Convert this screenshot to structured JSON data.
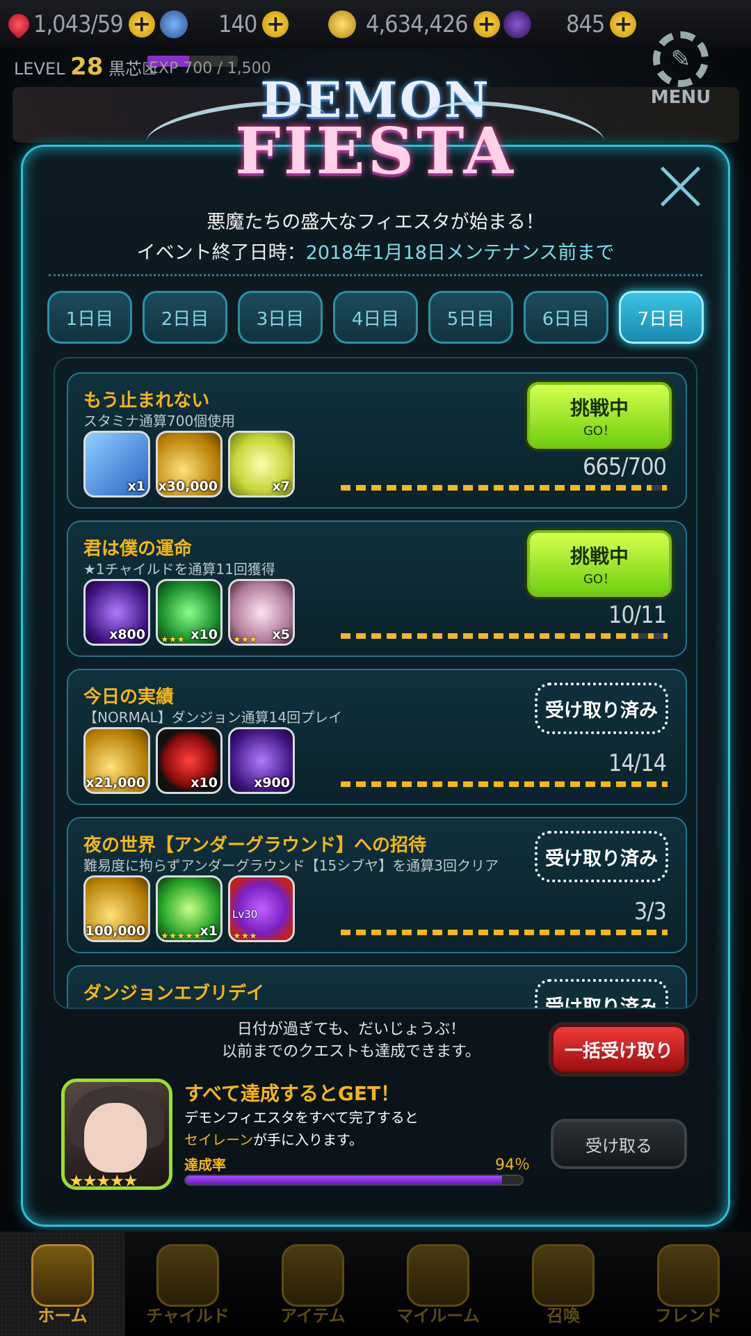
{
  "top": {
    "hearts": "1,043/59",
    "gems": "140",
    "coins": "4,634,426",
    "soul": "845",
    "level_label": "LEVEL",
    "level": "28",
    "player": "黒芯☒",
    "exp": "EXP 700 / 1,500",
    "menu": "MENU"
  },
  "logo": {
    "line1": "DEMON",
    "line2": "FIESTA"
  },
  "header": {
    "subtitle": "悪魔たちの盛大なフィエスタが始まる！",
    "end_label": "イベント終了日時：",
    "end_date": "2018年1月18日メンテナンス前まで"
  },
  "tabs": [
    "1日目",
    "2日目",
    "3日目",
    "4日目",
    "5日目",
    "6日目",
    "7日目"
  ],
  "active_tab": 6,
  "quests": [
    {
      "title": "もう止まれない",
      "desc": "スタミナ通算700個使用",
      "rewards": [
        {
          "icon": "bank-card-icon",
          "qty": "x1",
          "stars": ""
        },
        {
          "icon": "coin-pile-icon",
          "qty": "x30,000",
          "stars": ""
        },
        {
          "icon": "ticket-icon",
          "qty": "x7",
          "stars": ""
        }
      ],
      "progress": "665/700",
      "ratio": 0.95,
      "status": "go",
      "button": "挑戦中",
      "button_sub": "GO！"
    },
    {
      "title": "君は僕の運命",
      "desc": "★1チャイルドを通算11回獲得",
      "rewards": [
        {
          "icon": "purple-heart-gem-icon",
          "qty": "x800",
          "stars": ""
        },
        {
          "icon": "green-gem-icon",
          "qty": "x10",
          "stars": "★★★"
        },
        {
          "icon": "pink-gem-icon",
          "qty": "x5",
          "stars": "★★★"
        }
      ],
      "progress": "10/11",
      "ratio": 0.91,
      "status": "go",
      "button": "挑戦中",
      "button_sub": "GO！"
    },
    {
      "title": "今日の実績",
      "desc": "【NORMAL】ダンジョン通算14回プレイ",
      "rewards": [
        {
          "icon": "coin-pile-icon",
          "qty": "x21,000",
          "stars": ""
        },
        {
          "icon": "red-heart-icon",
          "qty": "x10",
          "stars": ""
        },
        {
          "icon": "purple-heart-gem-icon",
          "qty": "x900",
          "stars": ""
        }
      ],
      "progress": "14/14",
      "ratio": 1,
      "status": "done",
      "button": "受け取り済み",
      "button_sub": ""
    },
    {
      "title": "夜の世界【アンダーグラウンド】への招待",
      "desc": "難易度に拘らずアンダーグラウンド【15シブヤ】を通算3回クリア",
      "rewards": [
        {
          "icon": "coin-pile-icon",
          "qty": "x100,000",
          "stars": ""
        },
        {
          "icon": "green-orb-icon",
          "qty": "x1",
          "stars": "★★★★★"
        },
        {
          "icon": "purple-monster-icon",
          "qty": "",
          "stars": "★★★",
          "level": "Lv30"
        }
      ],
      "progress": "3/3",
      "ratio": 1,
      "status": "done",
      "button": "受け取り済み",
      "button_sub": ""
    },
    {
      "title": "ダンジョンエブリデイ",
      "desc": "",
      "rewards": [],
      "progress": "",
      "ratio": 1,
      "status": "done",
      "button": "受け取り済み",
      "button_sub": ""
    }
  ],
  "bottom": {
    "note1": "日付が過ぎても、だいじょうぶ！",
    "note2": "以前までのクエストも達成できます。",
    "claim_all": "一括受け取り",
    "get_title": "すべて達成するとGET！",
    "get_desc1": "デモンフィエスタをすべて完了すると",
    "get_name": "セイレーン",
    "get_desc2": "が手に入ります。",
    "rate_label": "達成率",
    "rate_pct": "94％",
    "rate": 0.94,
    "receive": "受け取る",
    "portrait_stars": "★★★★★"
  },
  "nav": [
    "ホーム",
    "チャイルド",
    "アイテム",
    "マイルーム",
    "召喚",
    "フレンド"
  ],
  "colors": {
    "accent": "#2fc3d8",
    "gold": "#f5b617",
    "go": "#9be71f",
    "claim": "#d91f1f"
  }
}
